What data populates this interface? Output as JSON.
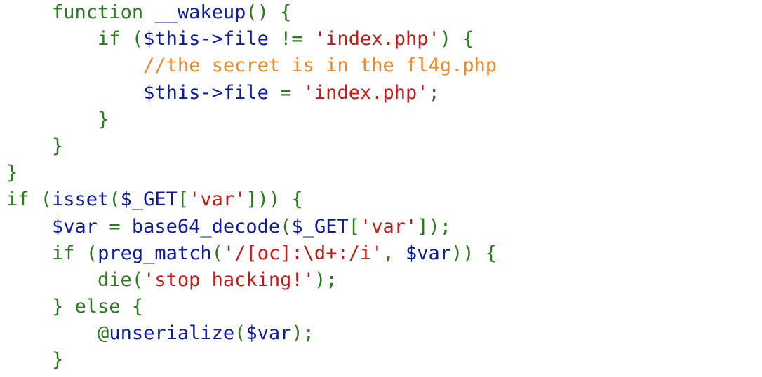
{
  "colors": {
    "keyword": "#2a7a1e",
    "identifier": "#0d1a9e",
    "string": "#c41a16",
    "comment": "#e8892f",
    "background": "#ffffff"
  },
  "lines": [
    {
      "indent": 2,
      "tokens": [
        {
          "t": "function ",
          "k": "kw"
        },
        {
          "t": "__wakeup",
          "k": "fn"
        },
        {
          "t": "() {",
          "k": "pn"
        }
      ]
    },
    {
      "indent": 4,
      "tokens": [
        {
          "t": "if (",
          "k": "kw"
        },
        {
          "t": "$this->file",
          "k": "var"
        },
        {
          "t": " != ",
          "k": "pn"
        },
        {
          "t": "'index.php'",
          "k": "st"
        },
        {
          "t": ") {",
          "k": "pn"
        }
      ]
    },
    {
      "indent": 6,
      "tokens": [
        {
          "t": "//the secret is in the fl4g.php",
          "k": "cm"
        }
      ]
    },
    {
      "indent": 6,
      "tokens": [
        {
          "t": "$this->file",
          "k": "var"
        },
        {
          "t": " = ",
          "k": "pn"
        },
        {
          "t": "'index.php'",
          "k": "st"
        },
        {
          "t": ";",
          "k": "pn"
        }
      ]
    },
    {
      "indent": 4,
      "tokens": [
        {
          "t": "}",
          "k": "pn"
        }
      ]
    },
    {
      "indent": 2,
      "tokens": [
        {
          "t": "}",
          "k": "pn"
        }
      ]
    },
    {
      "indent": 0,
      "tokens": [
        {
          "t": "}",
          "k": "pn"
        }
      ]
    },
    {
      "indent": 0,
      "tokens": [
        {
          "t": "if (",
          "k": "kw"
        },
        {
          "t": "isset",
          "k": "fn"
        },
        {
          "t": "(",
          "k": "pn"
        },
        {
          "t": "$_GET",
          "k": "var"
        },
        {
          "t": "[",
          "k": "pn"
        },
        {
          "t": "'var'",
          "k": "st"
        },
        {
          "t": "])) {",
          "k": "pn"
        }
      ]
    },
    {
      "indent": 2,
      "tokens": [
        {
          "t": "$var",
          "k": "var"
        },
        {
          "t": " = ",
          "k": "pn"
        },
        {
          "t": "base64_decode",
          "k": "fn"
        },
        {
          "t": "(",
          "k": "pn"
        },
        {
          "t": "$_GET",
          "k": "var"
        },
        {
          "t": "[",
          "k": "pn"
        },
        {
          "t": "'var'",
          "k": "st"
        },
        {
          "t": "]);",
          "k": "pn"
        }
      ]
    },
    {
      "indent": 2,
      "tokens": [
        {
          "t": "if (",
          "k": "kw"
        },
        {
          "t": "preg_match",
          "k": "fn"
        },
        {
          "t": "(",
          "k": "pn"
        },
        {
          "t": "'/[oc]:\\d+:/i'",
          "k": "st"
        },
        {
          "t": ", ",
          "k": "pn"
        },
        {
          "t": "$var",
          "k": "var"
        },
        {
          "t": ")) {",
          "k": "pn"
        }
      ]
    },
    {
      "indent": 4,
      "tokens": [
        {
          "t": "die",
          "k": "kw"
        },
        {
          "t": "(",
          "k": "pn"
        },
        {
          "t": "'stop hacking!'",
          "k": "st"
        },
        {
          "t": ");",
          "k": "pn"
        }
      ]
    },
    {
      "indent": 2,
      "tokens": [
        {
          "t": "} else {",
          "k": "pn"
        }
      ]
    },
    {
      "indent": 4,
      "tokens": [
        {
          "t": "@",
          "k": "kw"
        },
        {
          "t": "unserialize",
          "k": "fn"
        },
        {
          "t": "(",
          "k": "pn"
        },
        {
          "t": "$var",
          "k": "var"
        },
        {
          "t": ");",
          "k": "pn"
        }
      ]
    },
    {
      "indent": 2,
      "tokens": [
        {
          "t": "}",
          "k": "pn"
        }
      ]
    }
  ]
}
